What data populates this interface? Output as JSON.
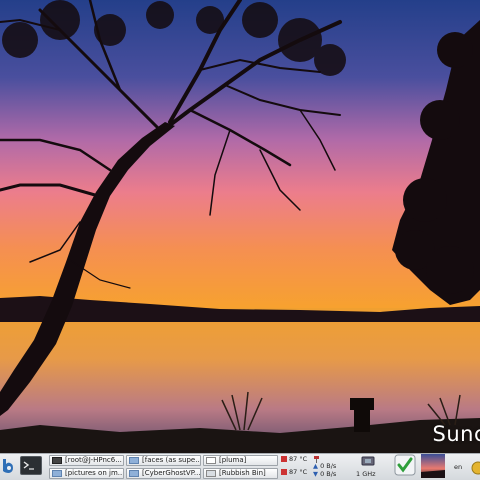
{
  "wallpaper": {
    "caption": "Sunc",
    "colors": {
      "sky_top": "#2b4a92",
      "sky_mid": "#c87ab0",
      "horizon": "#f7a332",
      "water": "#e99a3a",
      "silhouette": "#120a0c"
    }
  },
  "panel": {
    "launchers": [
      {
        "name": "browser-icon"
      },
      {
        "name": "terminal-icon"
      }
    ],
    "tasks": [
      {
        "label": "[root@J-HPnc6..."
      },
      {
        "label": "[faces (as supe..."
      },
      {
        "label": "[pluma]"
      },
      {
        "label": "[pictures on jm..."
      },
      {
        "label": "[CyberGhostVP..."
      },
      {
        "label": "[Rubbish Bin]"
      }
    ],
    "sensors": [
      {
        "value": "87 °C"
      },
      {
        "value": "87 °C"
      }
    ],
    "network": {
      "up": "0 B/s",
      "down": "0 B/s"
    },
    "cpu_freq": "1 GHz",
    "language": "en",
    "colors": {
      "panel_bg": "#dde1e5",
      "task_border": "#9ea4aa"
    }
  }
}
